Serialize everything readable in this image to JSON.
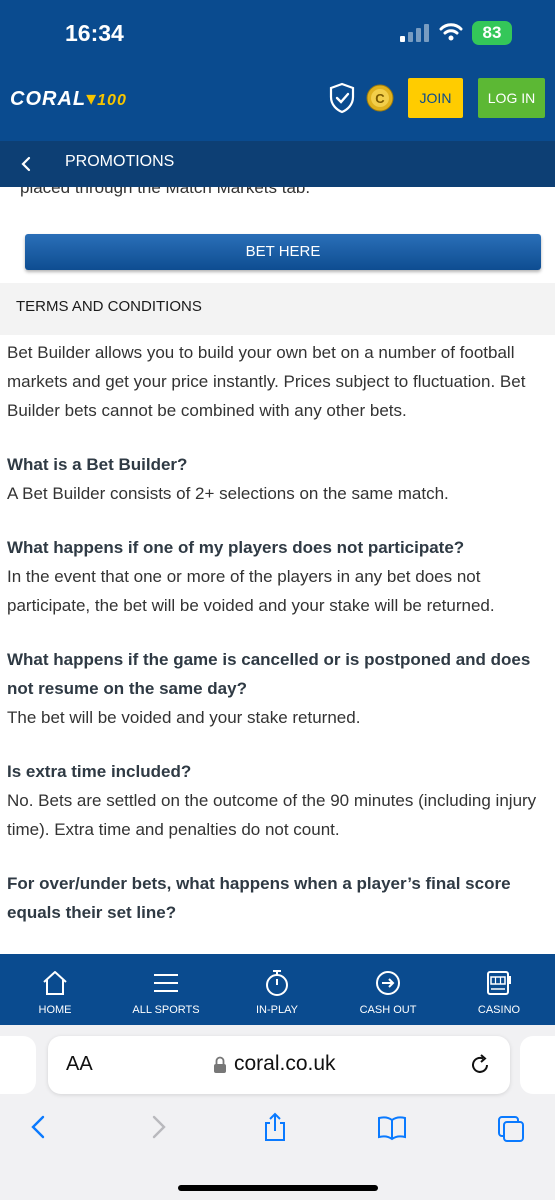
{
  "status": {
    "time": "16:34",
    "battery": "83"
  },
  "header": {
    "logo_text": "CORAL",
    "logo_suffix": "100",
    "join_label": "JOIN",
    "login_label": "LOG IN"
  },
  "subnav": {
    "title": "PROMOTIONS"
  },
  "content": {
    "cut_text": "placed through the Match Markets tab.",
    "bet_button": "BET HERE",
    "tc_title": "TERMS AND CONDITIONS",
    "intro": "Bet Builder allows you to build your own bet on a number of football markets and get your price instantly. Prices subject to fluctuation. Bet Builder bets cannot be combined with any other bets.",
    "faq": [
      {
        "q": "What is a Bet Builder?",
        "a": "A Bet Builder consists of 2+ selections on the same match."
      },
      {
        "q": "What happens if one of my players does not participate?",
        "a": "In the event that one or more of the players in any bet does not participate, the bet will be voided and your stake will be returned."
      },
      {
        "q": "What happens if the game is cancelled or is postponed and does not resume on the same day?",
        "a": "The bet will be voided and your stake returned."
      },
      {
        "q": "Is extra time included?",
        "a": "No. Bets are settled on the outcome of the 90 minutes (including injury time). Extra time and penalties do not count."
      },
      {
        "q": "For over/under bets, what happens when a player’s final score equals their set line?",
        "a": ""
      }
    ]
  },
  "bottom_nav": [
    {
      "label": "HOME",
      "icon": "home-icon"
    },
    {
      "label": "ALL SPORTS",
      "icon": "menu-icon"
    },
    {
      "label": "IN-PLAY",
      "icon": "stopwatch-icon"
    },
    {
      "label": "CASH OUT",
      "icon": "cash-out-icon"
    },
    {
      "label": "CASINO",
      "icon": "slot-machine-icon"
    }
  ],
  "browser": {
    "text_size_label": "AA",
    "url": "coral.co.uk"
  },
  "colors": {
    "brand_blue": "#0a4b8f",
    "join_yellow": "#ffcc00",
    "login_green": "#5cb834",
    "ios_blue": "#0a7aff"
  }
}
